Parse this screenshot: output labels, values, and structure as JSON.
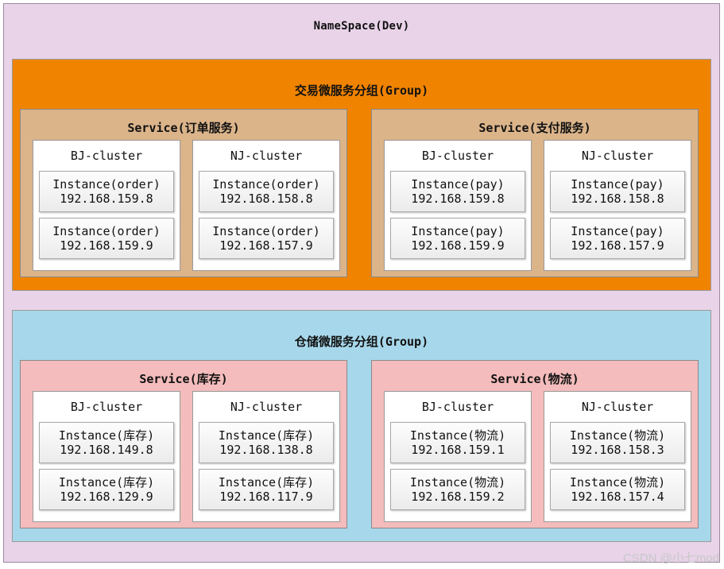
{
  "namespace": {
    "title": "NameSpace(Dev)"
  },
  "groups": [
    {
      "title": "交易微服务分组(Group)",
      "color": "#f08300",
      "service_color": "#dbb48a",
      "services": [
        {
          "title": "Service(订单服务)",
          "clusters": [
            {
              "title": "BJ-cluster",
              "instances": [
                {
                  "name": "Instance(order)",
                  "ip": "192.168.159.8"
                },
                {
                  "name": "Instance(order)",
                  "ip": "192.168.159.9"
                }
              ]
            },
            {
              "title": "NJ-cluster",
              "instances": [
                {
                  "name": "Instance(order)",
                  "ip": "192.168.158.8"
                },
                {
                  "name": "Instance(order)",
                  "ip": "192.168.157.9"
                }
              ]
            }
          ]
        },
        {
          "title": "Service(支付服务)",
          "clusters": [
            {
              "title": "BJ-cluster",
              "instances": [
                {
                  "name": "Instance(pay)",
                  "ip": "192.168.159.8"
                },
                {
                  "name": "Instance(pay)",
                  "ip": "192.168.159.9"
                }
              ]
            },
            {
              "title": "NJ-cluster",
              "instances": [
                {
                  "name": "Instance(pay)",
                  "ip": "192.168.158.8"
                },
                {
                  "name": "Instance(pay)",
                  "ip": "192.168.157.9"
                }
              ]
            }
          ]
        }
      ]
    },
    {
      "title": "仓储微服务分组(Group)",
      "color": "#a7d7ea",
      "service_color": "#f4bcbc",
      "services": [
        {
          "title": "Service(库存)",
          "clusters": [
            {
              "title": "BJ-cluster",
              "instances": [
                {
                  "name": "Instance(库存)",
                  "ip": "192.168.149.8"
                },
                {
                  "name": "Instance(库存)",
                  "ip": "192.168.129.9"
                }
              ]
            },
            {
              "title": "NJ-cluster",
              "instances": [
                {
                  "name": "Instance(库存)",
                  "ip": "192.168.138.8"
                },
                {
                  "name": "Instance(库存)",
                  "ip": "192.168.117.9"
                }
              ]
            }
          ]
        },
        {
          "title": "Service(物流)",
          "clusters": [
            {
              "title": "BJ-cluster",
              "instances": [
                {
                  "name": "Instance(物流)",
                  "ip": "192.168.159.1"
                },
                {
                  "name": "Instance(物流)",
                  "ip": "192.168.159.2"
                }
              ]
            },
            {
              "title": "NJ-cluster",
              "instances": [
                {
                  "name": "Instance(物流)",
                  "ip": "192.168.158.3"
                },
                {
                  "name": "Instance(物流)",
                  "ip": "192.168.157.4"
                }
              ]
            }
          ]
        }
      ]
    }
  ],
  "watermark": "CSDN @小七mod"
}
